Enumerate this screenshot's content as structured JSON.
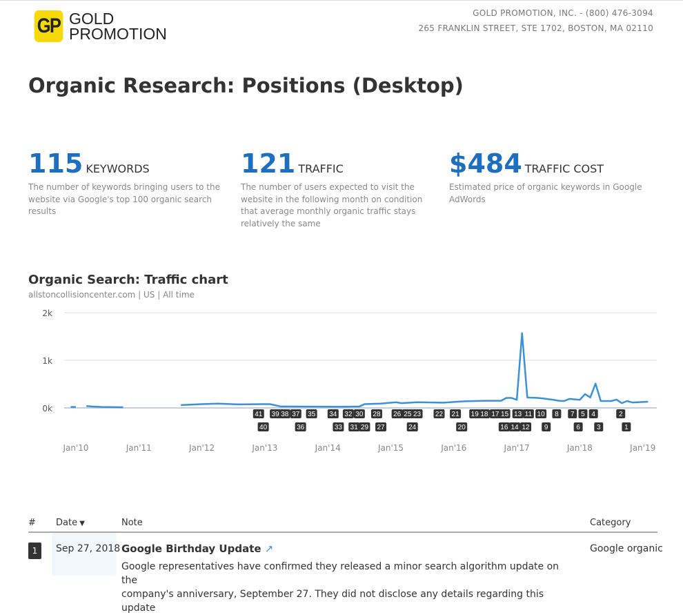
{
  "brand": {
    "logo_mark": "GP",
    "logo_line1": "GOLD",
    "logo_line2": "PROMOTION"
  },
  "contact": {
    "line1": "GOLD PROMOTION, INC. - (800) 476-3094",
    "line2": "265 FRANKLIN STREET, STE 1702, BOSTON, MA 02110"
  },
  "title": "Organic Research: Positions (Desktop)",
  "stats": [
    {
      "value": "115",
      "label": "KEYWORDS",
      "desc": "The number of keywords bringing users to the website via Google's top 100 organic search results"
    },
    {
      "value": "121",
      "label": "TRAFFIC",
      "desc": "The number of users expected to visit the website in the following month on condition that average monthly organic traffic stays relatively the same"
    },
    {
      "value": "$484",
      "label": "TRAFFIC COST",
      "desc": "Estimated price of organic keywords in Google AdWords"
    }
  ],
  "chart": {
    "title": "Organic Search: Traffic chart",
    "subtitle": "allstoncollisioncenter.com | US | All time"
  },
  "chart_data": {
    "type": "line",
    "ylim": [
      0,
      2000
    ],
    "yticks": [
      "0k",
      "1k",
      "2k"
    ],
    "xticks": [
      "Jan'10",
      "Jan'11",
      "Jan'12",
      "Jan'13",
      "Jan'14",
      "Jan'15",
      "Jan'16",
      "Jan'17",
      "Jan'18",
      "Jan'19"
    ],
    "grid": true,
    "color": "#3d8fd6",
    "segments": [
      [
        [
          "2009-12",
          20
        ],
        [
          "2010-01",
          20
        ]
      ],
      [
        [
          "2010-03",
          40
        ],
        [
          "2010-04",
          30
        ],
        [
          "2010-06",
          20
        ],
        [
          "2010-10",
          15
        ]
      ],
      [
        [
          "2011-09",
          60
        ],
        [
          "2012-01",
          80
        ],
        [
          "2012-04",
          90
        ],
        [
          "2012-08",
          75
        ],
        [
          "2013-02",
          80
        ],
        [
          "2013-04",
          30
        ],
        [
          "2014-03",
          25
        ],
        [
          "2014-07",
          30
        ],
        [
          "2014-08",
          80
        ],
        [
          "2014-11",
          90
        ],
        [
          "2015-02",
          120
        ],
        [
          "2015-03",
          100
        ],
        [
          "2015-06",
          120
        ],
        [
          "2015-11",
          110
        ],
        [
          "2016-03",
          140
        ],
        [
          "2016-07",
          150
        ],
        [
          "2016-10",
          150
        ],
        [
          "2016-11",
          210
        ],
        [
          "2016-12",
          210
        ],
        [
          "2017-01",
          170
        ],
        [
          "2017-02",
          1570
        ],
        [
          "2017-03",
          220
        ],
        [
          "2017-05",
          210
        ],
        [
          "2017-06",
          200
        ],
        [
          "2017-08",
          170
        ],
        [
          "2017-09",
          150
        ],
        [
          "2017-10",
          145
        ],
        [
          "2017-11",
          190
        ],
        [
          "2018-01",
          170
        ],
        [
          "2018-02",
          290
        ],
        [
          "2018-03",
          220
        ],
        [
          "2018-04",
          510
        ],
        [
          "2018-05",
          145
        ],
        [
          "2018-07",
          145
        ],
        [
          "2018-08",
          175
        ],
        [
          "2018-09",
          100
        ],
        [
          "2018-10",
          145
        ],
        [
          "2018-11",
          115
        ],
        [
          "2019-02",
          130
        ]
      ]
    ],
    "markers": [
      {
        "n": "41",
        "date": "2012-11-25"
      },
      {
        "n": "40",
        "date": "2012-12-22"
      },
      {
        "n": "39",
        "date": "2013-03-01"
      },
      {
        "n": "38",
        "date": "2013-04-25"
      },
      {
        "n": "37",
        "date": "2013-06-28"
      },
      {
        "n": "36",
        "date": "2013-07-25"
      },
      {
        "n": "35",
        "date": "2013-09-28"
      },
      {
        "n": "34",
        "date": "2014-02-01"
      },
      {
        "n": "33",
        "date": "2014-03-01"
      },
      {
        "n": "32",
        "date": "2014-04-28"
      },
      {
        "n": "31",
        "date": "2014-06-01"
      },
      {
        "n": "30",
        "date": "2014-07-01"
      },
      {
        "n": "29",
        "date": "2014-08-01"
      },
      {
        "n": "28",
        "date": "2014-10-10"
      },
      {
        "n": "27",
        "date": "2014-11-04"
      },
      {
        "n": "26",
        "date": "2015-02-07"
      },
      {
        "n": "25",
        "date": "2015-04-07"
      },
      {
        "n": "24",
        "date": "2015-05-04"
      },
      {
        "n": "23",
        "date": "2015-06-01"
      },
      {
        "n": "22",
        "date": "2015-10-07"
      },
      {
        "n": "21",
        "date": "2016-01-10"
      },
      {
        "n": "20",
        "date": "2016-02-16"
      },
      {
        "n": "19",
        "date": "2016-05-01"
      },
      {
        "n": "18",
        "date": "2016-06-25"
      },
      {
        "n": "17",
        "date": "2016-08-28"
      },
      {
        "n": "16",
        "date": "2016-10-19"
      },
      {
        "n": "15",
        "date": "2016-10-22"
      },
      {
        "n": "14",
        "date": "2016-12-19"
      },
      {
        "n": "13",
        "date": "2017-01-07"
      },
      {
        "n": "12",
        "date": "2017-02-22"
      },
      {
        "n": "11",
        "date": "2017-03-07"
      },
      {
        "n": "10",
        "date": "2017-05-19"
      },
      {
        "n": "9",
        "date": "2017-06-19"
      },
      {
        "n": "8",
        "date": "2017-08-19"
      },
      {
        "n": "7",
        "date": "2017-11-19"
      },
      {
        "n": "6",
        "date": "2017-12-22"
      },
      {
        "n": "5",
        "date": "2018-01-19"
      },
      {
        "n": "4",
        "date": "2018-03-19"
      },
      {
        "n": "3",
        "date": "2018-04-19"
      },
      {
        "n": "2",
        "date": "2018-08-25"
      },
      {
        "n": "1",
        "date": "2018-09-27"
      }
    ]
  },
  "table": {
    "headers": {
      "num": "#",
      "date": "Date",
      "note": "Note",
      "category": "Category"
    },
    "rows": [
      {
        "num": "1",
        "date": "Sep 27, 2018",
        "title": "Google Birthday Update",
        "text": "Google representatives have confirmed they released a minor search algorithm update on the",
        "text2": "company's anniversary, September 27. They did not disclose any details regarding this update",
        "category": "Google organic"
      }
    ]
  }
}
